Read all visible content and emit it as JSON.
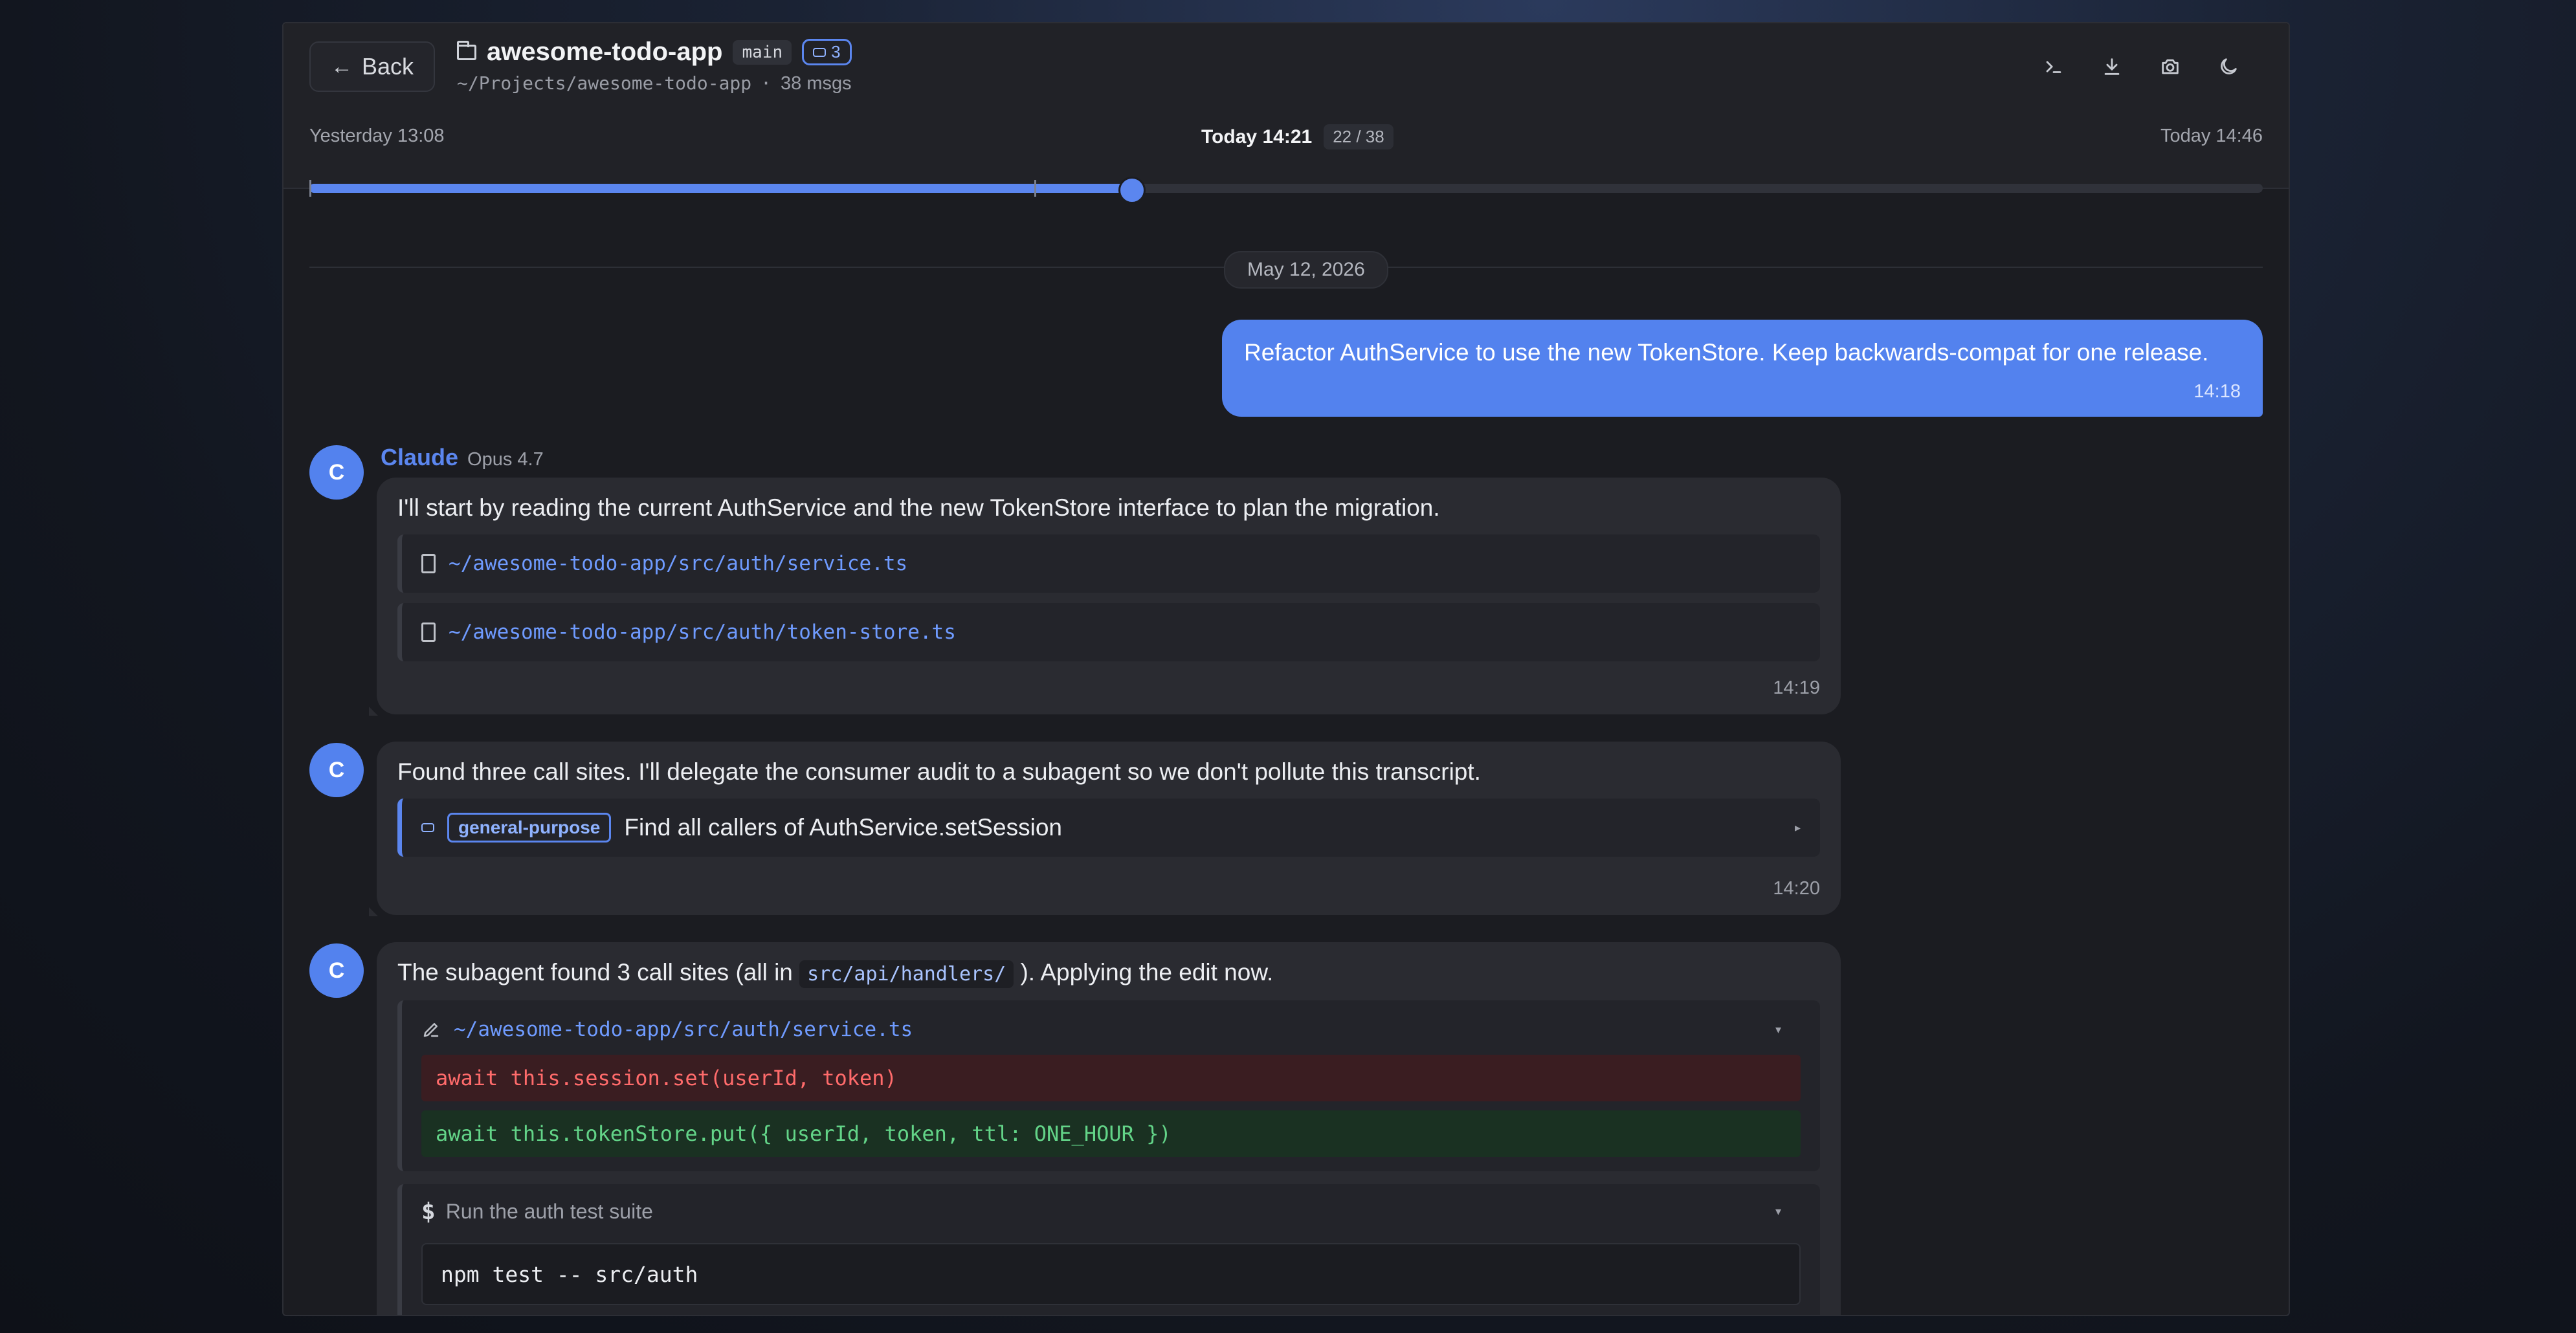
{
  "header": {
    "back_label": "Back",
    "title": "awesome-todo-app",
    "branch": "main",
    "agent_count": "3",
    "path": "~/Projects/awesome-todo-app",
    "separator": "·",
    "msg_count": "38 msgs",
    "icons": [
      "terminal-icon",
      "download-icon",
      "camera-icon",
      "moon-icon"
    ]
  },
  "timeline": {
    "start": "Yesterday 13:08",
    "current": "Today 14:21",
    "position": "22 / 38",
    "end": "Today 14:46",
    "progress": 0.42,
    "tick": 0.371
  },
  "conversation": {
    "date": "May 12, 2026",
    "user_message": {
      "text": "Refactor AuthService to use the new TokenStore. Keep backwards-compat for one release.",
      "time": "14:18"
    },
    "assistant": {
      "avatar": "C",
      "name": "Claude",
      "model": "Opus 4.7"
    },
    "messages": [
      {
        "text": "I'll start by reading the current AuthService and the new TokenStore interface to plan the migration.",
        "files": [
          "~/awesome-todo-app/src/auth/service.ts",
          "~/awesome-todo-app/src/auth/token-store.ts"
        ],
        "time": "14:19"
      },
      {
        "text": "Found three call sites. I'll delegate the consumer audit to a subagent so we don't pollute this transcript.",
        "agent_type": "general-purpose",
        "agent_task": "Find all callers of AuthService.setSession",
        "time": "14:20"
      },
      {
        "text_before": "The subagent found 3 call sites (all in",
        "code": "src/api/handlers/",
        "text_after": "). Applying the edit now.",
        "edit_file": "~/awesome-todo-app/src/auth/service.ts",
        "diff_removed": "await this.session.set(userId, token)",
        "diff_added": "await this.tokenStore.put({ userId, token, ttl: ONE_HOUR })",
        "bash_desc": "Run the auth test suite",
        "bash_prompt": "$",
        "bash_cmd": "npm test -- src/auth"
      }
    ]
  },
  "colors": {
    "accent": "#5382ee",
    "diff_removed": "#ff6b6b",
    "diff_added": "#63d488"
  }
}
